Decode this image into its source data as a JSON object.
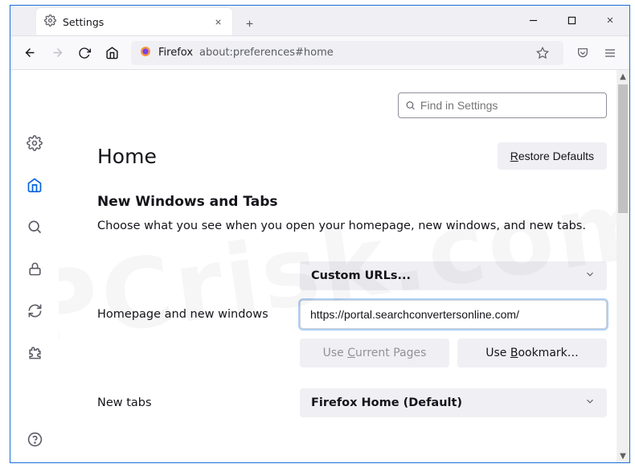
{
  "tab": {
    "title": "Settings"
  },
  "urlbar": {
    "brand": "Firefox",
    "url": "about:preferences#home"
  },
  "search": {
    "placeholder": "Find in Settings"
  },
  "page": {
    "title": "Home",
    "restore_label": "Restore Defaults",
    "restore_underline": "R",
    "section_heading": "New Windows and Tabs",
    "section_desc": "Choose what you see when you open your homepage, new windows, and new tabs."
  },
  "homepage": {
    "label": "Homepage and new windows",
    "select_value": "Custom URLs...",
    "url_value": "https://portal.searchconvertersonline.com/",
    "use_current_label": "Use Current Pages",
    "use_current_underline": "C",
    "use_bookmark_label": "Use Bookmark…",
    "use_bookmark_underline": "B"
  },
  "newtabs": {
    "label": "New tabs",
    "select_value": "Firefox Home (Default)"
  },
  "watermark": "PCrisk.com"
}
